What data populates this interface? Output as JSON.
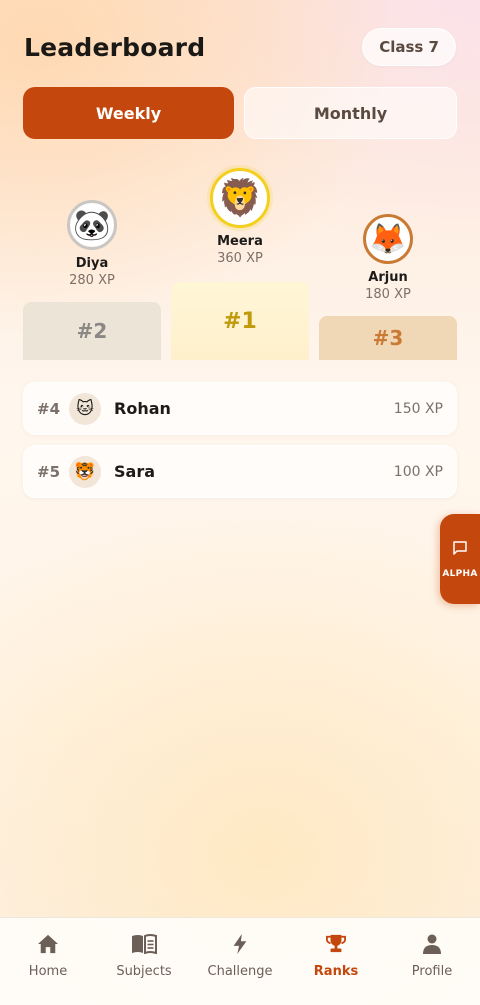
{
  "header": {
    "title": "Leaderboard",
    "class_badge": "Class 7"
  },
  "tabs": {
    "weekly": "Weekly",
    "monthly": "Monthly",
    "active": "Weekly"
  },
  "podium": {
    "first": {
      "rank": "#1",
      "name": "Meera",
      "xp": "360 XP",
      "avatar": "🦁",
      "icon": "lion-avatar"
    },
    "second": {
      "rank": "#2",
      "name": "Diya",
      "xp": "280 XP",
      "avatar": "🐼",
      "icon": "panda-avatar"
    },
    "third": {
      "rank": "#3",
      "name": "Arjun",
      "xp": "180 XP",
      "avatar": "🦊",
      "icon": "fox-avatar"
    }
  },
  "list": [
    {
      "rank": "#4",
      "name": "Rohan",
      "xp": "150 XP",
      "avatar": "🐱",
      "icon": "cat-avatar"
    },
    {
      "rank": "#5",
      "name": "Sara",
      "xp": "100 XP",
      "avatar": "🐯",
      "icon": "tiger-avatar"
    }
  ],
  "alpha": {
    "label": "ALPHA",
    "icon": "chat-bubble-icon"
  },
  "nav": {
    "home": "Home",
    "subjects": "Subjects",
    "challenge": "Challenge",
    "ranks": "Ranks",
    "profile": "Profile",
    "active": "Ranks"
  },
  "colors": {
    "accent": "#c4470d",
    "gold": "#c09a0a",
    "silver": "#8a8784",
    "bronze": "#c97b34"
  }
}
